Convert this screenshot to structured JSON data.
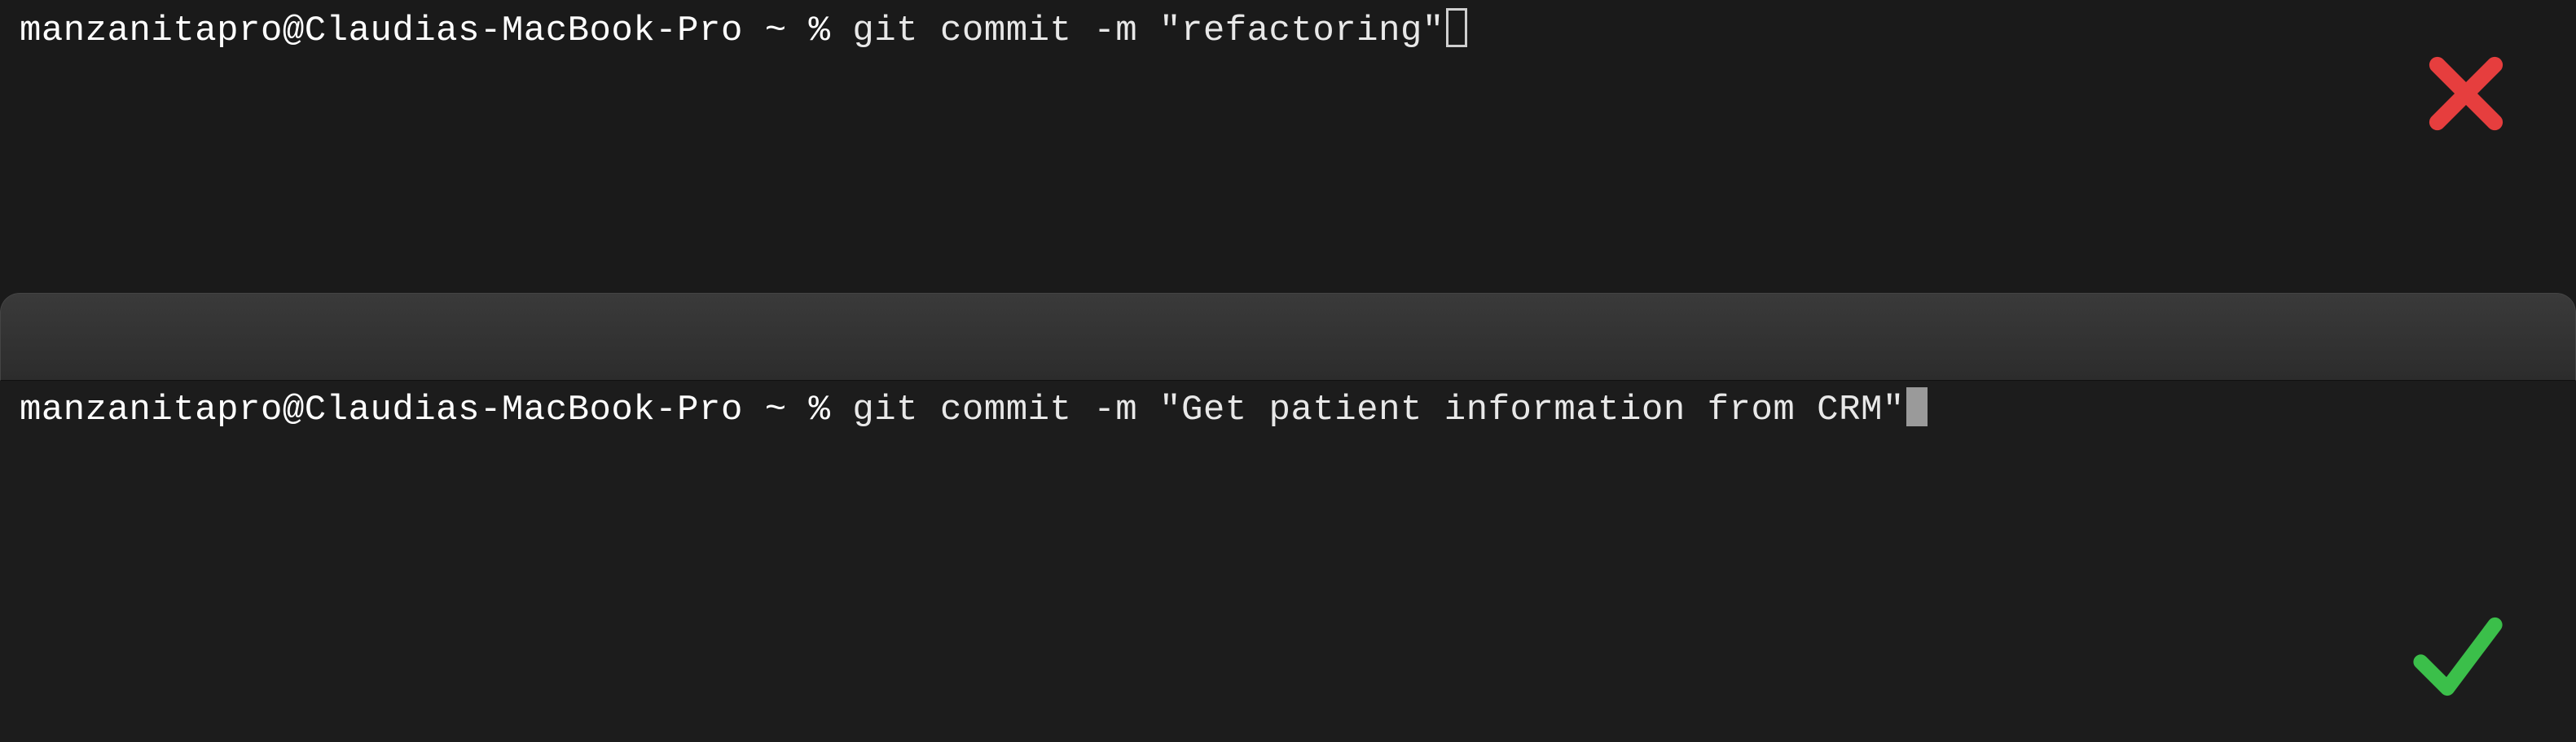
{
  "panes": {
    "top": {
      "prompt": "manzanitapro@Claudias-MacBook-Pro ~ % ",
      "command": "git commit -m \"refactoring\"",
      "status": "bad"
    },
    "bottom": {
      "prompt": "manzanitapro@Claudias-MacBook-Pro ~ % ",
      "command": "git commit -m \"Get patient information from CRM\"",
      "status": "good"
    }
  },
  "colors": {
    "bad": "#e63e3e",
    "good": "#3bbf4a"
  }
}
